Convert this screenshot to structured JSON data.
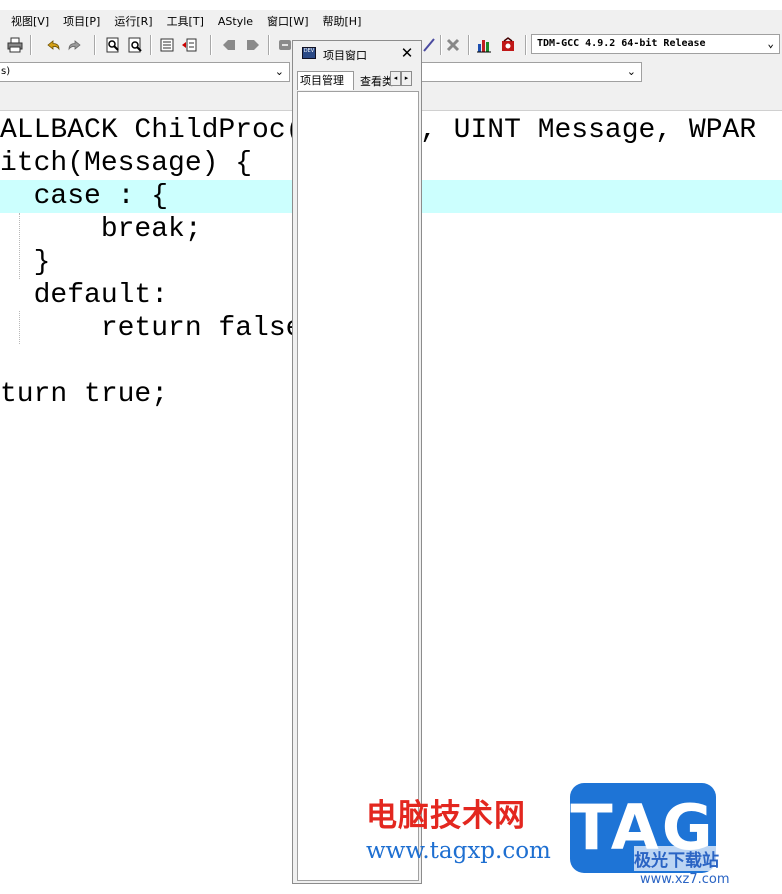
{
  "menu": {
    "items": [
      "视图[V]",
      "项目[P]",
      "运行[R]",
      "工具[T]",
      "AStyle",
      "窗口[W]",
      "帮助[H]"
    ]
  },
  "toolbar": {
    "compiler": "TDM-GCC 4.9.2 64-bit Release",
    "icons": [
      "print-icon",
      "undo-icon",
      "redo-icon",
      "find-icon",
      "replace-icon",
      "indent-icon",
      "unindent-icon",
      "bookmark-prev-icon",
      "bookmark-next-icon",
      "toggle-icon",
      "delete-icon",
      "chart-icon",
      "debug-icon"
    ]
  },
  "toolbar2": {
    "scope_combo_value": "s)",
    "symbol_combo_value": ""
  },
  "editor": {
    "lines": [
      "ALLBACK ChildProc(     nd, UINT Message, WPAR",
      "itch(Message) {",
      "  case : {",
      "      break;",
      "  }",
      "  default:",
      "      return false",
      "",
      "turn true;"
    ],
    "highlight_color": "#ccfffe"
  },
  "project_panel": {
    "title": "项目窗口",
    "icon_label": "DEV",
    "close_glyph": "✕",
    "tabs": [
      "项目管理",
      "查看类"
    ],
    "scroll_left": "◂",
    "scroll_right": "▸"
  },
  "watermark": {
    "cn": "电脑技术网",
    "url": "www.tagxp.com",
    "logo": "TAG",
    "site_cn": "极光下载站",
    "site_url": "www.xz7.com"
  }
}
